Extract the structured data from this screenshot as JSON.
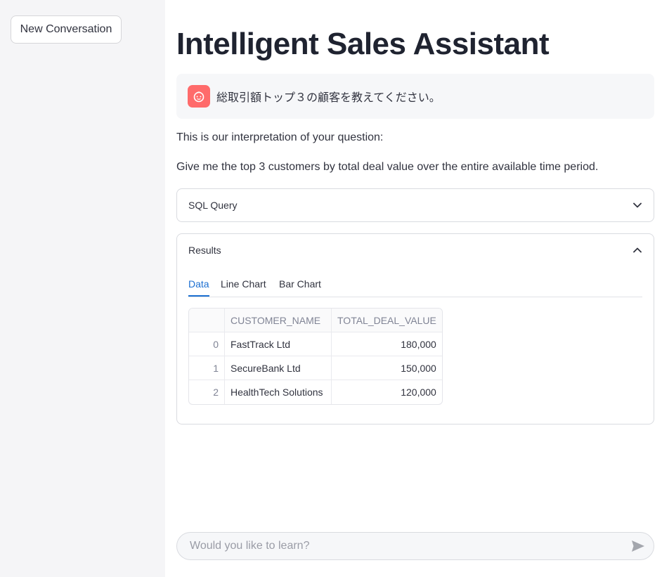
{
  "sidebar": {
    "new_conversation_label": "New Conversation"
  },
  "main": {
    "title": "Intelligent Sales Assistant",
    "user_message": "総取引額トップ３の顧客を教えてください。",
    "interpretation_label": "This is our interpretation of your question:",
    "interpretation_text": "Give me the top 3 customers by total deal value over the entire available time period.",
    "sql_expander": {
      "label": "SQL Query",
      "icon": "chevron-down-icon"
    },
    "results_expander": {
      "label": "Results",
      "icon": "chevron-up-icon",
      "tabs": [
        {
          "label": "Data",
          "active": true
        },
        {
          "label": "Line Chart",
          "active": false
        },
        {
          "label": "Bar Chart",
          "active": false
        }
      ],
      "table": {
        "columns": [
          "",
          "CUSTOMER_NAME",
          "TOTAL_DEAL_VALUE"
        ],
        "rows": [
          [
            "0",
            "FastTrack Ltd",
            "180,000"
          ],
          [
            "1",
            "SecureBank Ltd",
            "150,000"
          ],
          [
            "2",
            "HealthTech Solutions",
            "120,000"
          ]
        ]
      }
    }
  },
  "chat_input": {
    "placeholder": "Would you like to learn?",
    "send_icon": "send-icon"
  },
  "colors": {
    "accent": "#1c6fd1",
    "avatar": "#ff6b6b",
    "sidebar_bg": "#f5f5f7"
  }
}
